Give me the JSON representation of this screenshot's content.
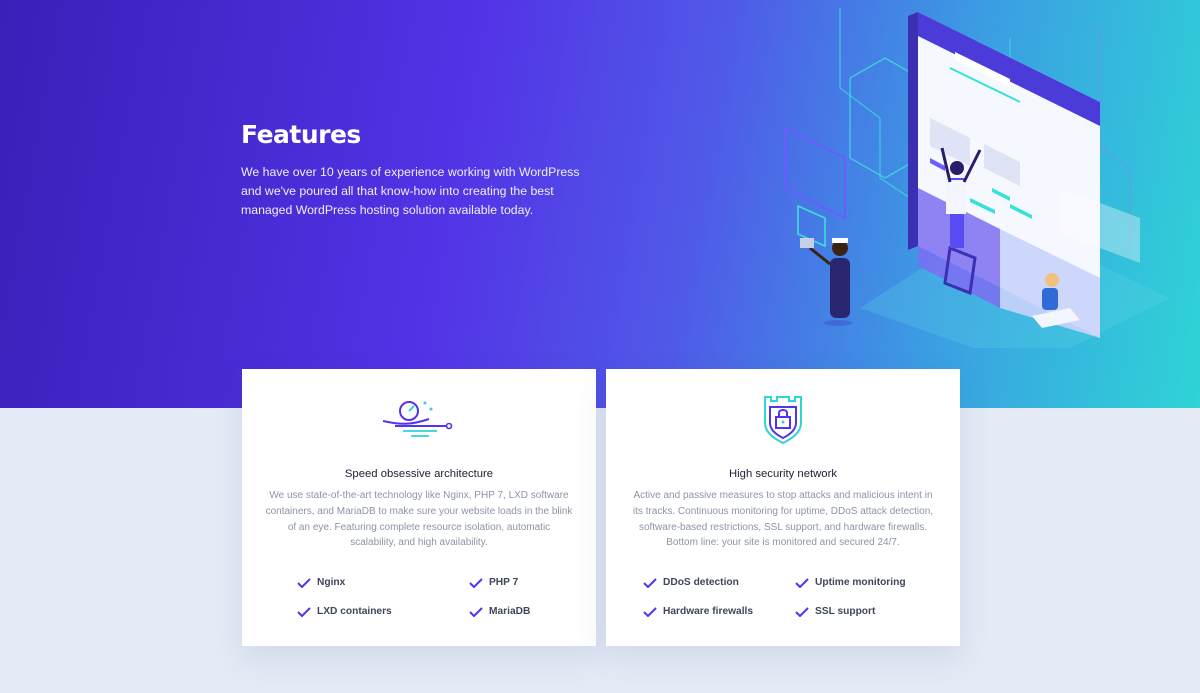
{
  "hero": {
    "title": "Features",
    "description": "We have over 10 years of experience working with WordPress and we've poured all that know-how into creating the best managed WordPress hosting solution available today."
  },
  "cards": [
    {
      "icon": "speed-icon",
      "title": "Speed obsessive architecture",
      "description": "We use state-of-the-art technology like Nginx, PHP 7, LXD software containers, and MariaDB to make sure your website loads in the blink of an eye. Featuring complete resource isolation, automatic scalability, and high availability.",
      "features": [
        "Nginx",
        "PHP 7",
        "LXD containers",
        "MariaDB"
      ]
    },
    {
      "icon": "security-shield-icon",
      "title": "High security network",
      "description": "Active and passive measures to stop attacks and malicious intent in its tracks. Continuous monitoring for uptime, DDoS attack detection, software-based restrictions, SSL support, and hardware firewalls. Bottom line: your site is monitored and secured 24/7.",
      "features": [
        "DDoS detection",
        "Uptime monitoring",
        "Hardware firewalls",
        "SSL support"
      ]
    }
  ],
  "colors": {
    "accent": "#5333ed",
    "teal": "#2ed4d6",
    "page_bg": "#e4ebf6"
  }
}
